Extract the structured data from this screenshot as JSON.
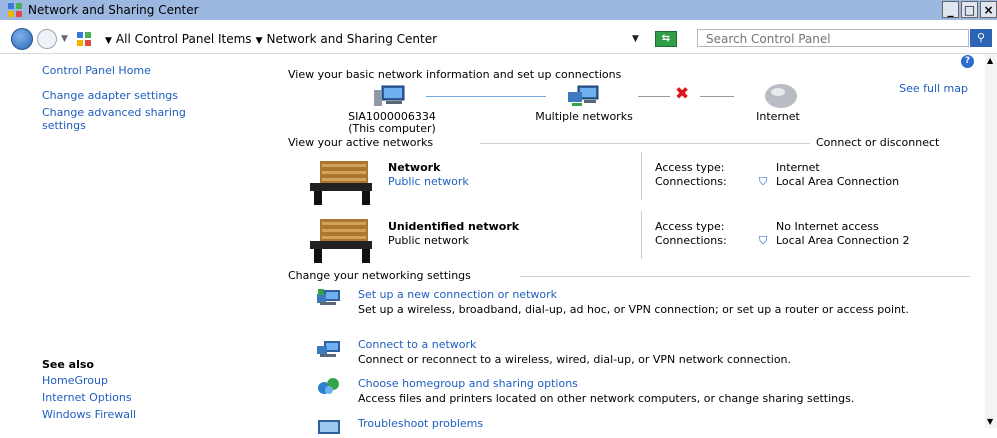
{
  "window": {
    "title": "Network and Sharing Center"
  },
  "window_buttons": {
    "minimize": "_",
    "maximize": "□",
    "close": "×"
  },
  "address": {
    "crumbs": [
      "All Control Panel Items",
      "Network and Sharing Center"
    ],
    "search_placeholder": "Search Control Panel"
  },
  "sidebar": {
    "items": [
      {
        "label": "Control Panel Home"
      },
      {
        "label": "Change adapter settings"
      },
      {
        "label": "Change advanced sharing settings"
      }
    ],
    "see_also_title": "See also",
    "see_also": [
      {
        "label": "HomeGroup"
      },
      {
        "label": "Internet Options"
      },
      {
        "label": "Windows Firewall"
      }
    ]
  },
  "main": {
    "title": "View your basic network information and set up connections",
    "see_full_map": "See full map",
    "map": {
      "computer": "SIA1000006334",
      "computer_sub": "(This computer)",
      "middle": "Multiple networks",
      "internet": "Internet"
    },
    "active_networks": {
      "heading": "View your active networks",
      "action": "Connect or disconnect",
      "networks": [
        {
          "name": "Network",
          "category": "Public network",
          "category_link": true,
          "access_label": "Access type:",
          "access_value": "Internet",
          "conn_label": "Connections:",
          "conn_value": "Local Area Connection"
        },
        {
          "name": "Unidentified network",
          "category": "Public network",
          "category_link": false,
          "access_label": "Access type:",
          "access_value": "No Internet access",
          "conn_label": "Connections:",
          "conn_value": "Local Area Connection 2"
        }
      ]
    },
    "settings": {
      "heading": "Change your networking settings",
      "items": [
        {
          "title": "Set up a new connection or network",
          "desc": "Set up a wireless, broadband, dial-up, ad hoc, or VPN connection; or set up a router or access point."
        },
        {
          "title": "Connect to a network",
          "desc": "Connect or reconnect to a wireless, wired, dial-up, or VPN network connection."
        },
        {
          "title": "Choose homegroup and sharing options",
          "desc": "Access files and printers located on other network computers, or change sharing settings."
        },
        {
          "title": "Troubleshoot problems",
          "desc": ""
        }
      ]
    }
  },
  "colors": {
    "link": "#1e5ebf",
    "titlebar": "#9cb8e0",
    "error_x": "#e0141c"
  }
}
